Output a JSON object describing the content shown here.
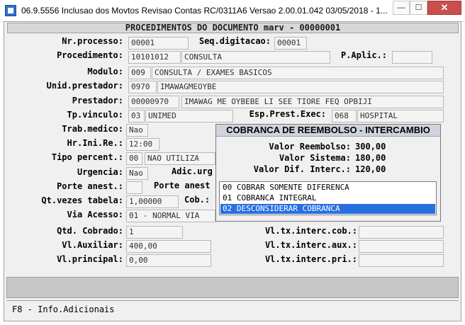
{
  "window": {
    "title": "06.9.5556  Inclusao  dos Movtos Revisao Contas RC/0311A6 Versao 2.00.01.042 03/05/2018 - 1...",
    "min_label": "—",
    "max_label": "☐",
    "close_label": "✕"
  },
  "header": {
    "title": "PROCEDIMENTOS DO DOCUMENTO marv - 00000001"
  },
  "form": {
    "nr_processo": {
      "label": "Nr.processo:",
      "value": "00001"
    },
    "seq_digitacao": {
      "label": "Seq.digitacao:",
      "value": "00001"
    },
    "procedimento": {
      "label": "Procedimento:",
      "code": "10101012",
      "desc": "CONSULTA"
    },
    "p_aplic": {
      "label": "P.Aplic.:",
      "value": ""
    },
    "modulo": {
      "label": "Modulo:",
      "code": "009",
      "desc": "CONSULTA / EXAMES BASICOS"
    },
    "unid_prestador": {
      "label": "Unid.prestador:",
      "code": "0970",
      "desc": "IMAWAGMEOYBE"
    },
    "prestador": {
      "label": "Prestador:",
      "code": "00000970",
      "desc": "IMAWAG ME OYBEBE LI SEE TIORE FEQ OPBIJI"
    },
    "tp_vinculo": {
      "label": "Tp.vinculo:",
      "code": "03",
      "desc": "UNIMED"
    },
    "esp_prest_exec": {
      "label": "Esp.Prest.Exec:",
      "code": "068",
      "desc": "HOSPITAL"
    },
    "trab_medico": {
      "label": "Trab.medico:",
      "value": "Nao"
    },
    "hr_ini_re": {
      "label": "Hr.Ini.Re.:",
      "value": "12:00"
    },
    "tipo_percent": {
      "label": "Tipo percent.:",
      "code": "00",
      "desc": "NAO UTILIZA"
    },
    "urgencia": {
      "label": "Urgencia:",
      "value": "Nao"
    },
    "adic_urg": {
      "label": "Adic.urg"
    },
    "porte_anest": {
      "label": "Porte anest.:",
      "value": ""
    },
    "porte_anest2": {
      "label": "Porte anest"
    },
    "qt_vezes_tabela": {
      "label": "Qt.vezes tabela:",
      "value": "1,00000"
    },
    "cob": {
      "label": "Cob.:"
    },
    "via_acesso": {
      "label": "Via Acesso:",
      "value": "01 - NORMAL VIA"
    },
    "qtd_cobrado": {
      "label": "Qtd. Cobrado:",
      "value": "1"
    },
    "vl_tx_interc_cob": {
      "label": "Vl.tx.interc.cob.:",
      "value": ""
    },
    "vl_auxiliar": {
      "label": "Vl.Auxiliar:",
      "value": "400,00"
    },
    "vl_tx_interc_aux": {
      "label": "Vl.tx.interc.aux.:",
      "value": ""
    },
    "vl_principal": {
      "label": "Vl.principal:",
      "value": "0,00"
    },
    "vl_tx_interc_pri": {
      "label": "Vl.tx.interc.pri.:",
      "value": ""
    }
  },
  "dialog": {
    "title": "COBRANCA DE REEMBOLSO - INTERCAMBIO",
    "valor_reembolso": {
      "label": "Valor Reembolso:",
      "value": "300,00"
    },
    "valor_sistema": {
      "label": "Valor Sistema:",
      "value": "180,00"
    },
    "valor_dif_interc": {
      "label": "Valor Dif. Interc.:",
      "value": "120,00"
    },
    "options": [
      "00 COBRAR SOMENTE DIFERENCA",
      "01 COBRANCA INTEGRAL",
      "02 DESCONSIDERAR COBRANCA"
    ],
    "selected_index": 2,
    "selection_color": "#2a6fe0"
  },
  "status": {
    "text": "F8 - Info.Adicionais"
  }
}
